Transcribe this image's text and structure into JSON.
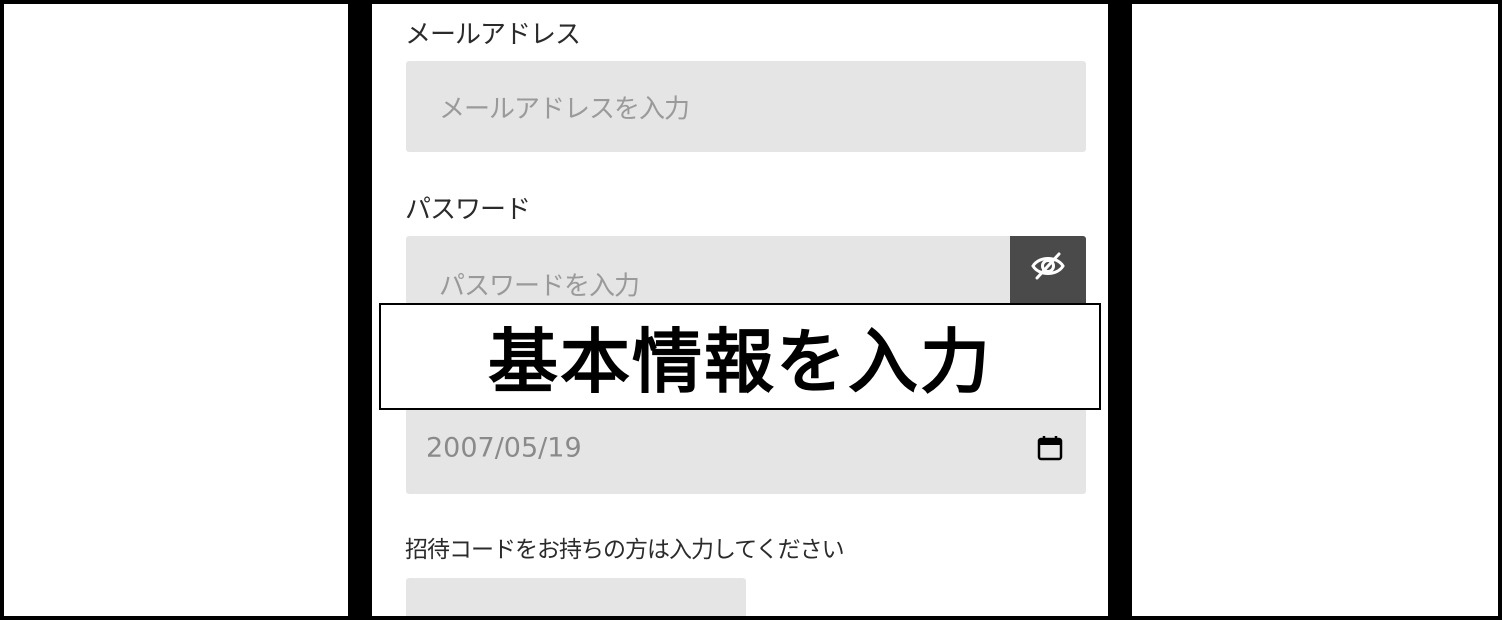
{
  "form": {
    "email": {
      "label": "メールアドレス",
      "placeholder": "メールアドレスを入力"
    },
    "password": {
      "label": "パスワード",
      "placeholder": "パスワードを入力",
      "toggle_icon": "eye-off-icon"
    },
    "birthdate": {
      "value": "2007/05/19",
      "picker_icon": "calendar-icon"
    },
    "invite_code": {
      "label": "招待コードをお持ちの方は入力してください"
    }
  },
  "banner": {
    "title": "基本情報を入力"
  },
  "colors": {
    "field_bg": "#e5e5e5",
    "toggle_bg": "#4a4a4a",
    "device_frame": "#000000"
  }
}
